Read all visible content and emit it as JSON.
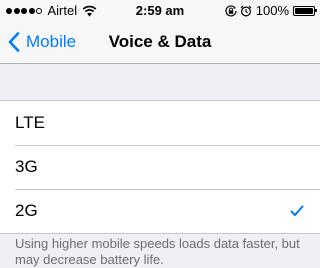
{
  "status_bar": {
    "signal_total": 5,
    "signal_filled": 4,
    "carrier": "Airtel",
    "time": "2:59 am",
    "battery_percent": "100%",
    "battery_level": 1.0,
    "icons": [
      "wifi-icon",
      "orientation-lock-icon",
      "alarm-icon",
      "battery-icon"
    ]
  },
  "nav": {
    "back_label": "Mobile",
    "title": "Voice & Data"
  },
  "options": [
    {
      "label": "LTE",
      "selected": false
    },
    {
      "label": "3G",
      "selected": false
    },
    {
      "label": "2G",
      "selected": true
    }
  ],
  "footer": "Using higher mobile speeds loads data faster, but may decrease battery life.",
  "colors": {
    "accent": "#007aff",
    "background": "#efeff4",
    "footer_text": "#6d6d72"
  }
}
